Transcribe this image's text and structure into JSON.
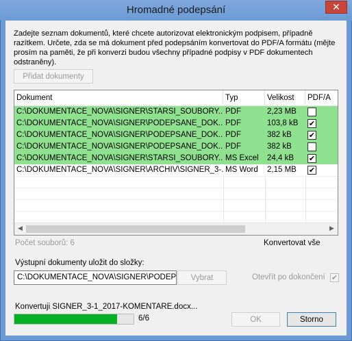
{
  "window": {
    "title": "Hromadné podepsání",
    "close_glyph": "✕"
  },
  "intro_text": "Zadejte seznam dokumentů, které chcete autorizovat elektronickým podpisem, případně razítkem. Určete, zda se má dokument před podepsáním konvertovat do PDF/A formátu (mějte prosím na paměti, že při konverzi budou všechny případné podpisy v PDF dokumentech odstraněny).",
  "add_button": "Přidat dokumenty",
  "table": {
    "columns": [
      "Dokument",
      "Typ",
      "Velikost",
      "PDF/A"
    ],
    "rows": [
      {
        "doc": "C:\\DOKUMENTACE_NOVA\\SIGNER\\STARSI_SOUBORY...",
        "type": "PDF",
        "size": "2,23 MB",
        "pdfa": "",
        "ok": true
      },
      {
        "doc": "C:\\DOKUMENTACE_NOVA\\SIGNER\\PODEPSANE_DOK...",
        "type": "PDF",
        "size": "103,8 kB",
        "pdfa": "✔",
        "ok": true
      },
      {
        "doc": "C:\\DOKUMENTACE_NOVA\\SIGNER\\PODEPSANE_DOK...",
        "type": "PDF",
        "size": "382 kB",
        "pdfa": "✔",
        "ok": true
      },
      {
        "doc": "C:\\DOKUMENTACE_NOVA\\SIGNER\\PODEPSANE_DOK...",
        "type": "PDF",
        "size": "382 kB",
        "pdfa": "",
        "ok": true
      },
      {
        "doc": "C:\\DOKUMENTACE_NOVA\\SIGNER\\STARSI_SOUBORY...",
        "type": "MS Excel",
        "size": "24,4 kB",
        "pdfa": "✔",
        "ok": true
      },
      {
        "doc": "C:\\DOKUMENTACE_NOVA\\SIGNER\\ARCHIV\\SIGNER_3-...",
        "type": "MS Word",
        "size": "2,15 MB",
        "pdfa": "✔",
        "ok": false
      }
    ],
    "scroll_left": "◀",
    "scroll_right": "▶"
  },
  "file_count": "Počet souborů: 6",
  "convert_all": "Konvertovat vše",
  "output": {
    "label": "Výstupní dokumenty uložit do složky:",
    "path": "C:\\DOKUMENTACE_NOVA\\SIGNER\\PODEPSANE",
    "browse_button": "Vybrat",
    "open_label": "Otevřít po dokončení",
    "open_checked": "✔"
  },
  "status": "Konvertuji SIGNER_3-1_2017-KOMENTARE.docx...",
  "progress": {
    "fraction": 1.0,
    "text": "6/6"
  },
  "ok_button": "OK",
  "cancel_button": "Storno",
  "colors": {
    "row_ok": "#8fe08f",
    "progress": "#06b025",
    "title_bar": "#6b9ad4",
    "close": "#c7463c"
  }
}
